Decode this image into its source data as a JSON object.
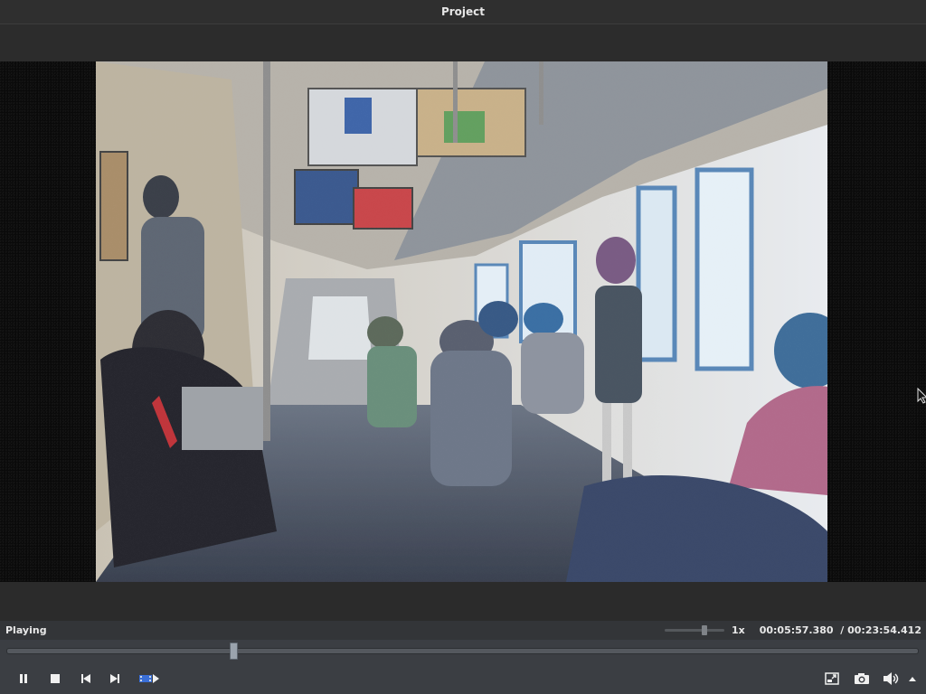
{
  "window": {
    "title": "Project"
  },
  "player": {
    "status": "Playing",
    "speed": "1x",
    "speed_slider_value": 0.65,
    "current_time": "00:05:57.380",
    "time_separator": "/",
    "total_time": "00:23:54.412",
    "seek_position_fraction": 0.249
  },
  "controls": {
    "left": [
      "pause-icon",
      "stop-icon",
      "previous-icon",
      "next-icon",
      "frame-step-icon"
    ],
    "right": [
      "fullscreen-icon",
      "snapshot-icon",
      "volume-icon",
      "menu-arrow-icon"
    ]
  },
  "colors": {
    "background": "#2b2b2b",
    "controls_bar": "#3b3e43",
    "text": "#e8e8e8",
    "accent": "#3a6fd8"
  }
}
